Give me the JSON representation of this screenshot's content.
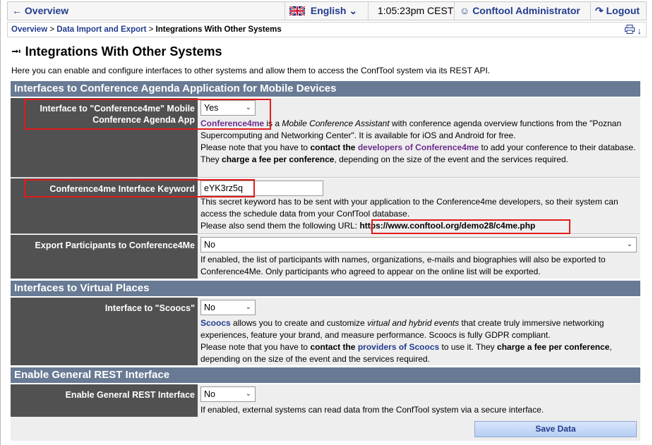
{
  "topbar": {
    "back_label": "Overview",
    "language": "English",
    "time": "1:05:23pm CEST",
    "user": "Conftool Administrator",
    "logout": "Logout"
  },
  "breadcrumb": {
    "items": [
      "Overview",
      "Data Import and Export"
    ],
    "current": "Integrations With Other Systems"
  },
  "page": {
    "title": "Integrations With Other Systems",
    "intro": "Here you can enable and configure interfaces to other systems and allow them to access the ConfTool system via its REST API."
  },
  "sections": {
    "mobile": "Interfaces to Conference Agenda Application for Mobile Devices",
    "virtual": "Interfaces to Virtual Places",
    "rest": "Enable General REST Interface"
  },
  "conf4me": {
    "label": "Interface to \"Conference4me\" Mobile Conference Agenda App",
    "value": "Yes",
    "link": "Conference4me",
    "desc1a": " is a ",
    "desc1b": "Mobile Conference Assistant",
    "desc1c": " with conference agenda overview functions from the \"Poznan Supercomputing and Networking Center\". It is available for iOS and Android for free.",
    "desc2a": "Please note that you have to ",
    "desc2b": "contact the",
    "desc2c": "developers of Conference4me",
    "desc2d": " to add your conference to their database. They ",
    "desc2e": "charge a fee per conference",
    "desc2f": ", depending on the size of the event and the services required."
  },
  "keyword": {
    "label": "Conference4me Interface Keyword",
    "value": "eYK3rz5q",
    "desc1": "This secret keyword has to be sent with your application to the Conference4me developers, so their system can access the schedule data from your ConfTool database.",
    "desc2": "Please also send them the following URL: ",
    "url": "https://www.conftool.org/demo28/c4me.php"
  },
  "export": {
    "label": "Export Participants to Conference4Me",
    "value": "No",
    "desc": "If enabled, the list of participants with names, organizations, e-mails and biographies will also be exported to Conference4Me. Only participants who agreed to appear on the online list will be exported."
  },
  "scoocs": {
    "label": "Interface to \"Scoocs\"",
    "value": "No",
    "link": "Scoocs",
    "desc1a": " allows you to create and customize ",
    "desc1b": "virtual and hybrid events",
    "desc1c": " that create truly immersive networking experiences, feature your brand, and measure performance. Scoocs is fully GDPR compliant.",
    "desc2a": "Please note that you have to ",
    "desc2b": "contact the",
    "desc2c": "providers of Scoocs",
    "desc2d": " to use it. They ",
    "desc2e": "charge a fee per conference",
    "desc2f": ", depending on the size of the event and the services required."
  },
  "rest": {
    "label": "Enable General REST Interface",
    "value": "No",
    "desc": "If enabled, external systems can read data from the ConfTool system via a secure interface."
  },
  "save_label": "Save Data"
}
